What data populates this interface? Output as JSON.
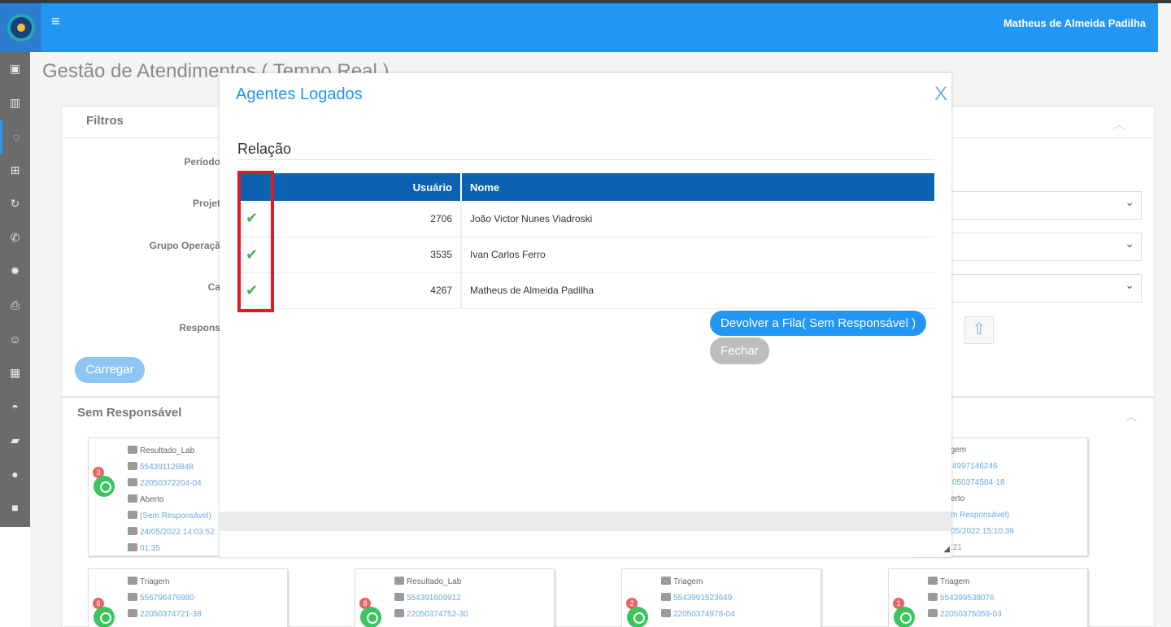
{
  "header": {
    "user_name": "Matheus de Almeida Padilha",
    "menu_icon": "hamburger-icon",
    "brand_color": "#2196f3"
  },
  "sidebar": {
    "items": [
      {
        "icon": "briefcase-icon",
        "glyph": "▣"
      },
      {
        "icon": "bar-chart-icon",
        "glyph": "▥"
      },
      {
        "icon": "whatsapp-icon",
        "glyph": "◌"
      },
      {
        "icon": "plus-square-icon",
        "glyph": "⊞"
      },
      {
        "icon": "refresh-icon",
        "glyph": "↻"
      },
      {
        "icon": "phone-icon",
        "glyph": "✆"
      },
      {
        "icon": "gear-icon",
        "glyph": "✹"
      },
      {
        "icon": "print-icon",
        "glyph": "⎙"
      },
      {
        "icon": "smile-icon",
        "glyph": "☺"
      },
      {
        "icon": "calendar-icon",
        "glyph": "▦"
      },
      {
        "icon": "dashboard-icon",
        "glyph": "◓"
      },
      {
        "icon": "chat-icon",
        "glyph": "▰"
      },
      {
        "icon": "comment-icon",
        "glyph": "●"
      },
      {
        "icon": "video-icon",
        "glyph": "■"
      }
    ]
  },
  "page": {
    "title": "Gestão de Atendimentos ( Tempo Real )"
  },
  "filters": {
    "heading": "Filtros",
    "labels": {
      "period": "Período",
      "project": "Projet",
      "operation_group": "Grupo Operaçã",
      "field4": "Ca",
      "responsible": "Respons"
    },
    "load_button": "Carregar"
  },
  "unassigned": {
    "heading": "Sem Responsável",
    "cards": [
      {
        "badge": "3",
        "queue": "Resultado_Lab",
        "phone": "554391126848",
        "protocol": "22050372204-04",
        "status": "Aberto",
        "owner": "(Sem Responsável)",
        "date": "24/05/2022 14:03:52",
        "elapsed": "01:35"
      },
      {
        "badge": "",
        "queue": "iagem",
        "phone": "4997146246",
        "protocol": "050374584-18",
        "status": "erto",
        "owner": "m Responsável)",
        "date": "05/2022 15:10:39",
        "elapsed": ":21"
      },
      {
        "badge": "6",
        "queue": "Triagem",
        "phone": "556796476980",
        "protocol": "22050374721-38"
      },
      {
        "badge": "8",
        "queue": "Resultado_Lab",
        "phone": "554391609912",
        "protocol": "22050374752-30"
      },
      {
        "badge": "2",
        "queue": "Triagem",
        "phone": "5543991523649",
        "protocol": "22050374978-04"
      },
      {
        "badge": "1",
        "queue": "Triagem",
        "phone": "554399538076",
        "protocol": "22050375059-03"
      }
    ]
  },
  "modal": {
    "title": "Agentes Logados",
    "close_label": "X",
    "subtitle": "Relação",
    "columns": {
      "user": "Usuário",
      "name": "Nome"
    },
    "rows": [
      {
        "checked": "✔",
        "user": "2706",
        "name": "João Victor Nunes Viadroski"
      },
      {
        "checked": "✔",
        "user": "3535",
        "name": "Ivan Carlos Ferro"
      },
      {
        "checked": "✔",
        "user": "4267",
        "name": "Matheus de Almeida Padilha"
      }
    ],
    "return_button": "Devolver a Fila( Sem Responsável )",
    "close_button": "Fechar",
    "header_color": "#0b62b0",
    "highlight_color": "#e01b24"
  }
}
